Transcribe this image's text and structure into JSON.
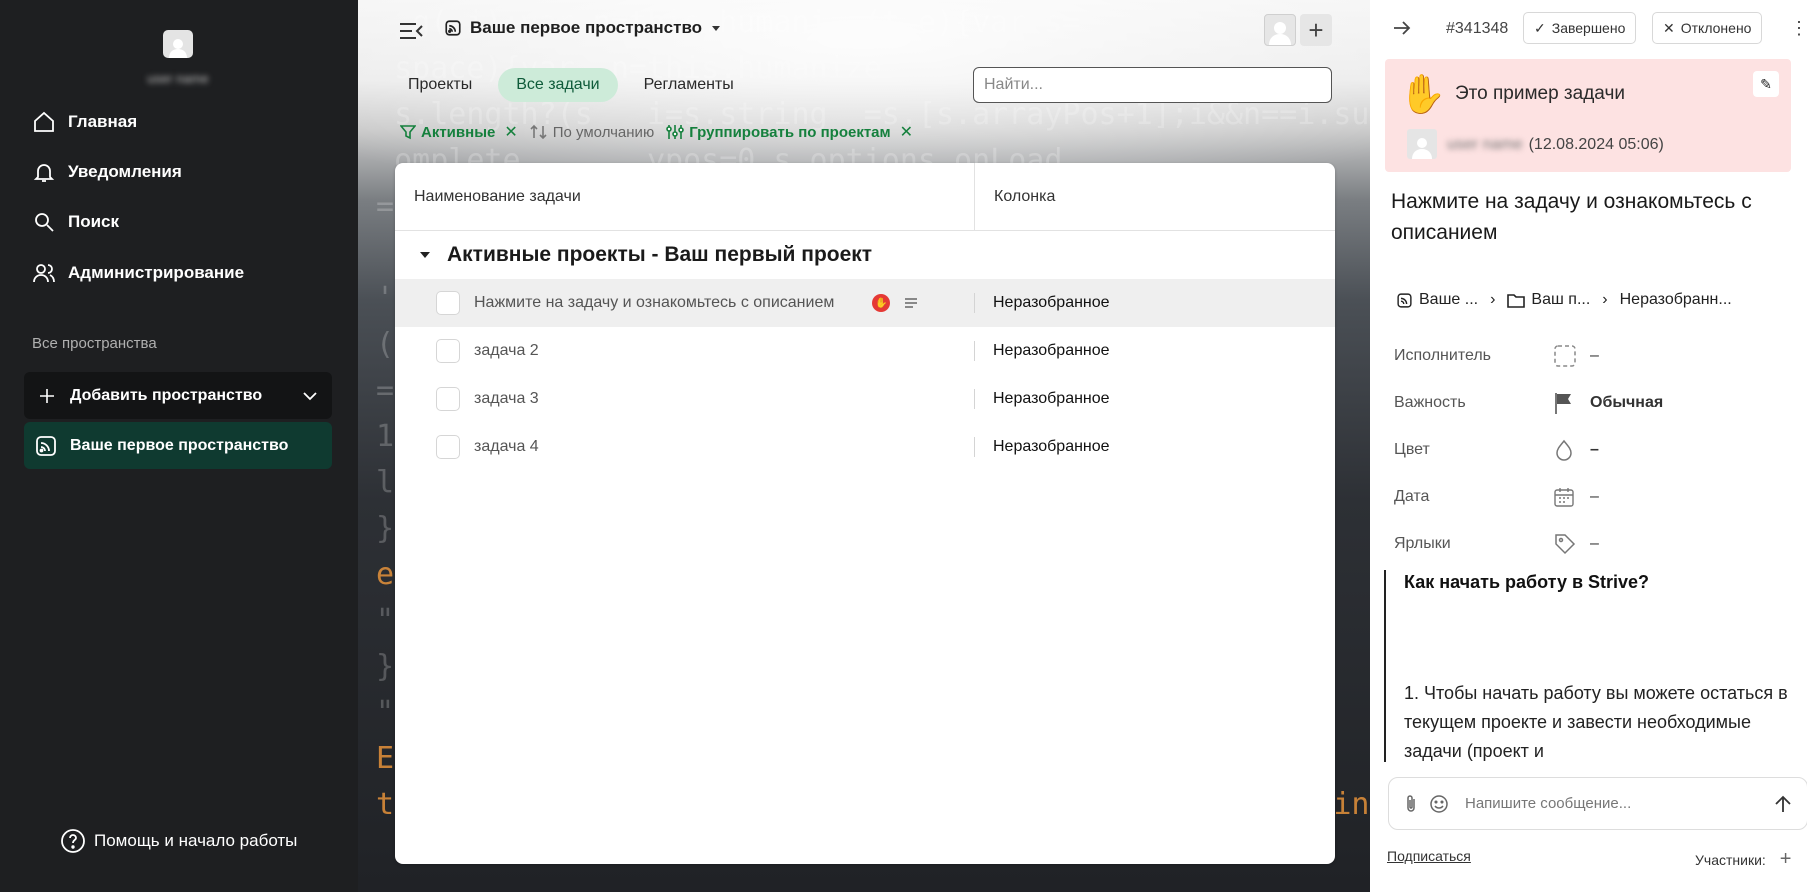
{
  "sidebar": {
    "user_name": "user name",
    "nav": [
      {
        "label": "Главная",
        "icon": "home-icon"
      },
      {
        "label": "Уведомления",
        "icon": "bell-icon"
      },
      {
        "label": "Поиск",
        "icon": "search-icon"
      },
      {
        "label": "Администрирование",
        "icon": "users-icon"
      }
    ],
    "section_label": "Все пространства",
    "add_space_label": "Добавить пространство",
    "space_label": "Ваше первое пространство",
    "help_label": "Помощь и начало работы"
  },
  "main": {
    "space_title": "Ваше первое пространство",
    "tabs": [
      {
        "label": "Проекты"
      },
      {
        "label": "Все задачи",
        "active": true
      },
      {
        "label": "Регламенты"
      }
    ],
    "search_placeholder": "Найти...",
    "filters": {
      "active": "Активные",
      "sort": "По умолчанию",
      "group": "Группировать по проектам"
    },
    "table": {
      "col_name": "Наименование задачи",
      "col_column": "Колонка",
      "group_title": "Активные проекты - Ваш первый проект",
      "rows": [
        {
          "name": "Нажмите на задачу и ознакомьтесь с описанием",
          "column": "Неразобранное"
        },
        {
          "name": "задача 2",
          "column": "Неразобранное"
        },
        {
          "name": "задача 3",
          "column": "Неразобранное"
        },
        {
          "name": "задача 4",
          "column": "Неразобранное"
        }
      ]
    }
  },
  "panel": {
    "task_id": "#341348",
    "done_label": "Завершено",
    "rejected_label": "Отклонено",
    "example_title": "Это пример задачи",
    "example_user": "user name",
    "example_date": "(12.08.2024 05:06)",
    "task_title": "Нажмите на задачу и ознакомьтесь с описанием",
    "crumbs": [
      "Ваше ...",
      "Ваш п...",
      "Неразобранн..."
    ],
    "props": {
      "assignee_label": "Исполнитель",
      "assignee_value": "–",
      "priority_label": "Важность",
      "priority_value": "Обычная",
      "color_label": "Цвет",
      "color_value": "–",
      "date_label": "Дата",
      "date_value": "–",
      "tags_label": "Ярлыки",
      "tags_value": "–"
    },
    "desc_heading": "Как начать работу в Strive?",
    "desc_text": "1. Чтобы начать работу вы можете остаться в текущем проекте и завести необходимые задачи (проект и",
    "message_placeholder": "Напишите сообщение...",
    "subscribe_label": "Подписаться",
    "members_label": "Участники:"
  },
  "colors": {
    "sidebar_bg": "#1e1f21",
    "active_space_bg": "#0f3a30",
    "accent_green": "#15803d",
    "active_tab_bg": "#cdebd9",
    "example_bg": "#fde2e2"
  }
}
